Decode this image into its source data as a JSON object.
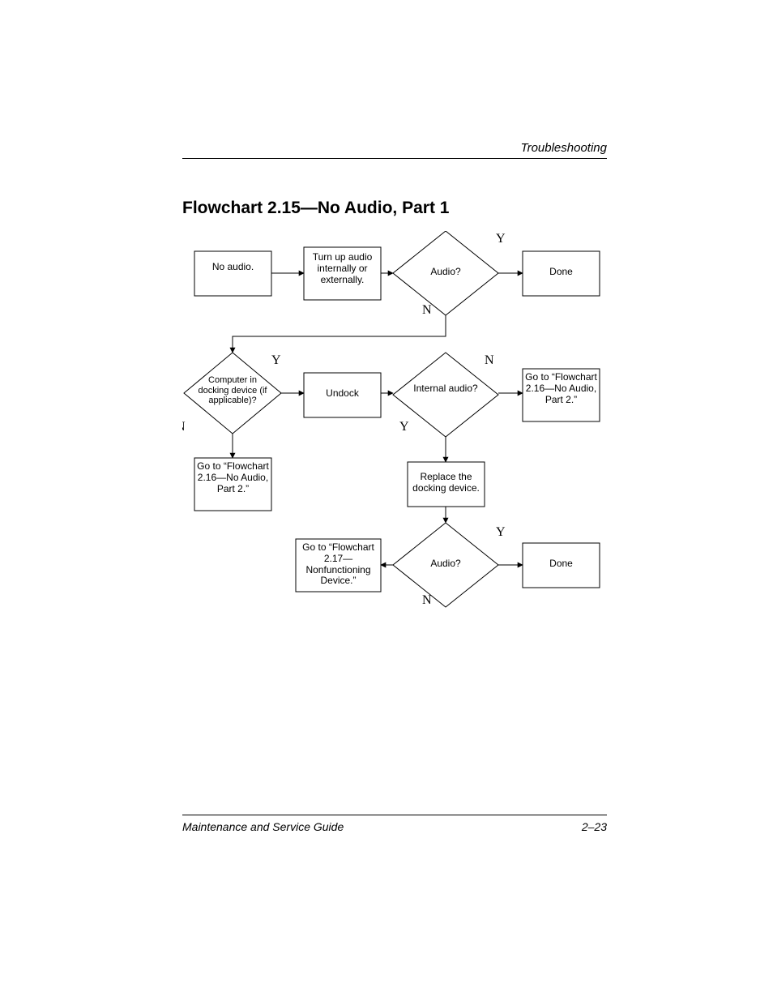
{
  "header": {
    "section": "Troubleshooting"
  },
  "title": "Flowchart 2.15—No Audio, Part 1",
  "footer": {
    "left": "Maintenance and Service Guide",
    "right": "2–23"
  },
  "flow": {
    "labels": {
      "y1": "Y",
      "n1": "N",
      "y2": "Y",
      "n2": "N",
      "y3": "Y",
      "n3": "N",
      "y4": "Y",
      "n4": "N"
    },
    "nodes": {
      "noaudio": "No audio.",
      "turnup": "Turn up audio internally or externally.",
      "audio1": "Audio?",
      "done1": "Done",
      "dock": "Computer in docking device (if applicable)?",
      "undock": "Undock",
      "intaudio": "Internal audio?",
      "goto216a_pre": "Go to ",
      "goto216a_link": "“Flowchart 2.16—No Audio, Part 2.”",
      "goto216b_pre": "Go to ",
      "goto216b_link": "“Flowchart 2.16—No Audio, Part 2.”",
      "replace": "Replace the docking device.",
      "audio2": "Audio?",
      "done2": "Done",
      "goto217_pre": "Go to ",
      "goto217_link": "“Flowchart 2.17—Nonfunctioning Device.”"
    }
  }
}
